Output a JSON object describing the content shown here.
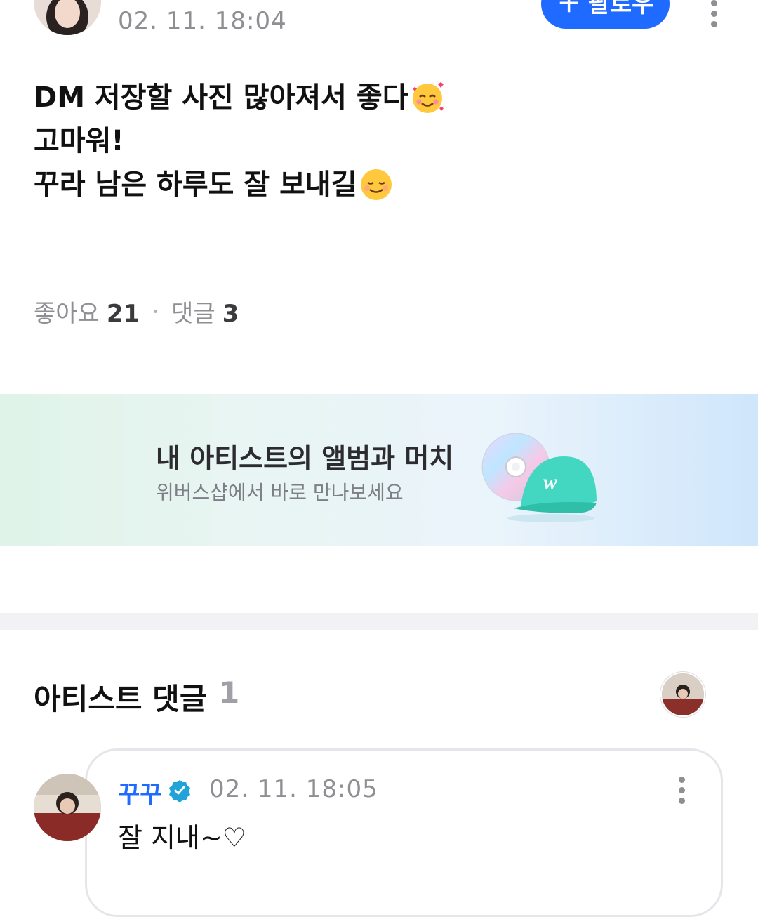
{
  "post": {
    "timestamp": "02. 11. 18:04",
    "follow_label": "팔로우",
    "lines": [
      {
        "text": "DM 저장할 사진 많아져서 좋다",
        "emoji": "smiling-face-with-hearts-icon"
      },
      {
        "text": "고마워!",
        "emoji": null
      },
      {
        "text": "꾸라 남은 하루도 잘 보내길",
        "emoji": "smiling-face-icon"
      }
    ],
    "likes_label": "좋아요",
    "likes_count": "21",
    "comments_label": "댓글",
    "comments_count": "3"
  },
  "banner": {
    "title": "내 아티스트의 앨범과 머치",
    "subtitle": "위버스샵에서 바로 만나보세요",
    "art_icons": [
      "cd-icon",
      "cap-icon"
    ]
  },
  "artist_comments": {
    "title": "아티스트 댓글",
    "count": "1"
  },
  "comment": {
    "author": "꾸꾸",
    "timestamp": "02. 11. 18:05",
    "text": "잘 지내~♡"
  },
  "colors": {
    "accent": "#1f6bff",
    "muted": "#8e8e93"
  }
}
